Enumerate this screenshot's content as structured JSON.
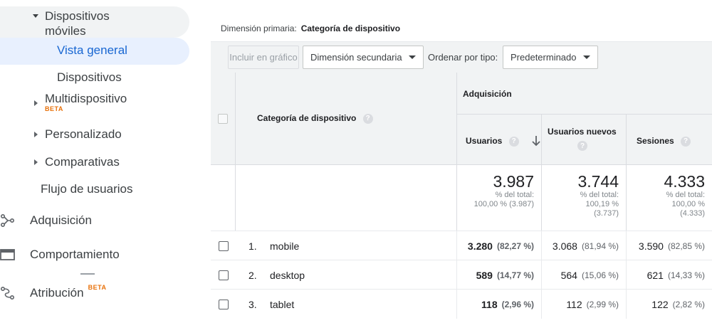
{
  "sidebar": {
    "parent": {
      "label_line1": "Dispositivos",
      "label_line2": "móviles"
    },
    "items": [
      {
        "label": "Vista general"
      },
      {
        "label": "Dispositivos"
      },
      {
        "label": "Multidispositivo",
        "badge": "BETA"
      },
      {
        "label": "Personalizado"
      },
      {
        "label": "Comparativas"
      },
      {
        "label": "Flujo de usuarios"
      }
    ],
    "sections": [
      {
        "label": "Adquisición",
        "icon": "acquisition-icon"
      },
      {
        "label": "Comportamiento",
        "icon": "behavior-icon"
      },
      {
        "label": "Atribución",
        "badge": "BETA",
        "icon": "attribution-icon"
      }
    ]
  },
  "primary_dimension": {
    "label": "Dimensión primaria:",
    "value": "Categoría de dispositivo"
  },
  "toolbar": {
    "include_chart": "Incluir en gráfico",
    "secondary_dimension": "Dimensión secundaria",
    "sort_label": "Ordenar por tipo:",
    "sort_value": "Predeterminado"
  },
  "table": {
    "dimension_header": "Categoría de dispositivo",
    "group_header": "Adquisición",
    "columns": [
      {
        "label": "Usuarios"
      },
      {
        "label": "Usuarios nuevos"
      },
      {
        "label": "Sesiones"
      }
    ],
    "totals": [
      {
        "value": "3.987",
        "line1": "% del total:",
        "line2": "100,00 % (3.987)",
        "line3": ""
      },
      {
        "value": "3.744",
        "line1": "% del total:",
        "line2": "100,19 %",
        "line3": "(3.737)"
      },
      {
        "value": "4.333",
        "line1": "% del total:",
        "line2": "100,00 %",
        "line3": "(4.333)"
      }
    ],
    "rows": [
      {
        "index": "1.",
        "name": "mobile",
        "users": "3.280",
        "users_pct": "(82,27 %)",
        "new_users": "3.068",
        "new_users_pct": "(81,94 %)",
        "sessions": "3.590",
        "sessions_pct": "(82,85 %)"
      },
      {
        "index": "2.",
        "name": "desktop",
        "users": "589",
        "users_pct": "(14,77 %)",
        "new_users": "564",
        "new_users_pct": "(15,06 %)",
        "sessions": "621",
        "sessions_pct": "(14,33 %)"
      },
      {
        "index": "3.",
        "name": "tablet",
        "users": "118",
        "users_pct": "(2,96 %)",
        "new_users": "112",
        "new_users_pct": "(2,99 %)",
        "sessions": "122",
        "sessions_pct": "(2,82 %)"
      }
    ]
  },
  "colors": {
    "accent": "#1a73e8",
    "selected_bg": "#e8f0fe",
    "beta": "#e8710a",
    "header_bg": "#f1f3f4"
  }
}
